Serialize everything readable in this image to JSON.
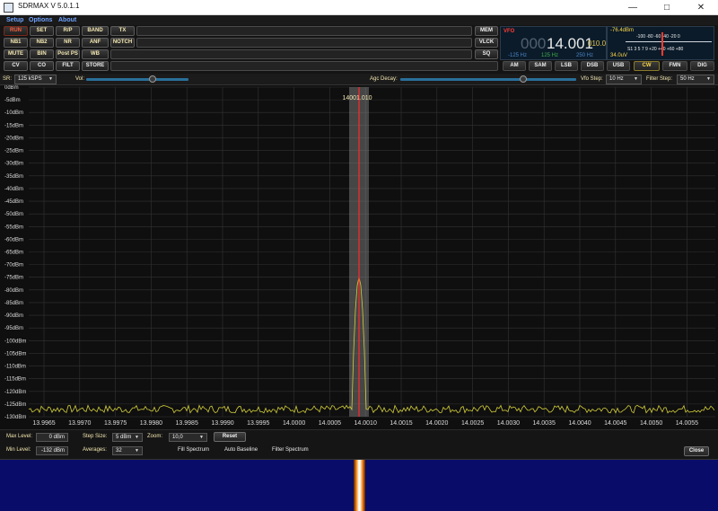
{
  "window": {
    "title": "SDRMAX V 5.0.1.1",
    "minimize_icon": "minimize-icon",
    "maximize_icon": "maximize-icon",
    "close_icon": "close-icon"
  },
  "menu": [
    "Setup",
    "Options",
    "About"
  ],
  "buttons_row1": [
    "RUN",
    "SET",
    "R/P",
    "BAND",
    "TX"
  ],
  "buttons_row2": [
    "NB1",
    "NB2",
    "NR",
    "ANF",
    "NOTCH"
  ],
  "buttons_row3": [
    "MUTE",
    "BIN",
    "Post PS",
    "WB"
  ],
  "buttons_row4": [
    "CV",
    "CO",
    "FILT",
    "STORE"
  ],
  "side_buttons": [
    "MEM",
    "VLCK",
    "SQ"
  ],
  "modes": [
    "AM",
    "SAM",
    "LSB",
    "DSB",
    "USB",
    "CW",
    "FMN",
    "DIG"
  ],
  "active_mode": "CW",
  "vfo": {
    "label": "VFO",
    "dim_digits": "000",
    "frequency": "14.001",
    "small": "010.0",
    "low": "-125 Hz",
    "mid": "125 Hz",
    "bw": "250 Hz"
  },
  "smeter": {
    "level": "-76.4dBm",
    "uv": "34.0uV",
    "top_scale": "-100 -80 -60 -40 -20 0",
    "bottom_scale": "S1 3 5 7 9 +20 +40 +60 +80"
  },
  "params": {
    "sr_label": "SR:",
    "sr_value": "125 kSPS",
    "vol_label": "Vol:",
    "vol_level": 0.65,
    "agc_label": "Agc Decay:",
    "agc_level": 0.7,
    "vfo_step_label": "Vfo Step:",
    "vfo_step_value": "10 Hz",
    "filter_step_label": "Filter Step:",
    "filter_step_value": "50 Hz"
  },
  "spectrum": {
    "marker": "14001.010",
    "y_labels": [
      "0dBm",
      "-5dBm",
      "-10dBm",
      "-15dBm",
      "-20dBm",
      "-25dBm",
      "-30dBm",
      "-35dBm",
      "-40dBm",
      "-45dBm",
      "-50dBm",
      "-55dBm",
      "-60dBm",
      "-65dBm",
      "-70dBm",
      "-75dBm",
      "-80dBm",
      "-85dBm",
      "-90dBm",
      "-95dBm",
      "-100dBm",
      "-105dBm",
      "-110dBm",
      "-115dBm",
      "-120dBm",
      "-125dBm",
      "-130dBm"
    ],
    "x_labels": [
      "13.9965",
      "13.9970",
      "13.9975",
      "13.9980",
      "13.9985",
      "13.9990",
      "13.9995",
      "14.0000",
      "14.0005",
      "14.0010",
      "14.0015",
      "14.0020",
      "14.0025",
      "14.0030",
      "14.0035",
      "14.0040",
      "14.0045",
      "14.0050",
      "14.0055"
    ],
    "noise_floor_dbm": -127,
    "peak_dbm": -75,
    "trace_color": "#d4cf3a",
    "marker_color": "#ff2a2a"
  },
  "settings": {
    "max_level_label": "Max Level:",
    "max_level_value": "0 dBm",
    "min_level_label": "Min Level:",
    "min_level_value": "-132 dBm",
    "step_size_label": "Step Size:",
    "step_size_value": "5 dBm",
    "averages_label": "Averages:",
    "averages_value": "32",
    "zoom_label": "Zoom:",
    "zoom_value": "10,0",
    "reset_label": "Reset",
    "fill_spectrum": "Fill Spectrum",
    "auto_baseline": "Auto Baseline",
    "filter_spectrum": "Filter Spectrum",
    "close_label": "Close"
  }
}
